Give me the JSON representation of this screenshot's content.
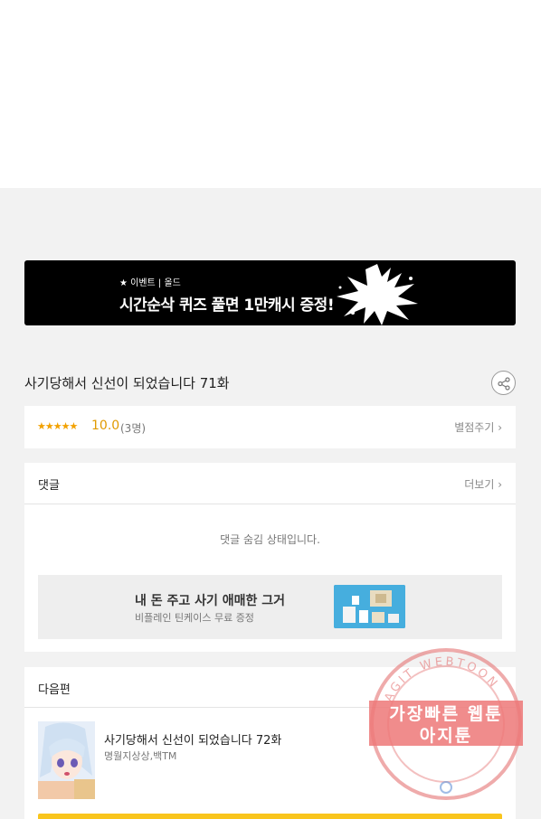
{
  "banner": {
    "small_text": "★ 이벤트 | 올드",
    "big_text": "시간순삭 퀴즈 풀면 1만캐시 증정!"
  },
  "episode": {
    "title": "사기당해서 신선이 되었습니다 71화"
  },
  "rating": {
    "stars": "★★★★★",
    "score": "10.0",
    "count": "(3명)",
    "rate_button": "별점주기 ›"
  },
  "comments": {
    "header": "댓글",
    "more": "더보기 ›",
    "hidden_message": "댓글 숨김 상태입니다.",
    "ad": {
      "title": "내 돈 주고 사기 애매한 그거",
      "subtitle": "비플레인 틴케이스 무료 증정"
    }
  },
  "next_episode": {
    "header": "다음편",
    "title": "사기당해서 신선이 되었습니다 72화",
    "author": "명월지상상,백TM"
  },
  "watermark": {
    "line1": "가장빠른 웹툰",
    "line2": "아지툰",
    "ring_text": "AGIT WEBTOON"
  },
  "colors": {
    "accent_star": "#f2a100",
    "cta_yellow": "#f9c51d",
    "watermark_red": "#e57373"
  }
}
